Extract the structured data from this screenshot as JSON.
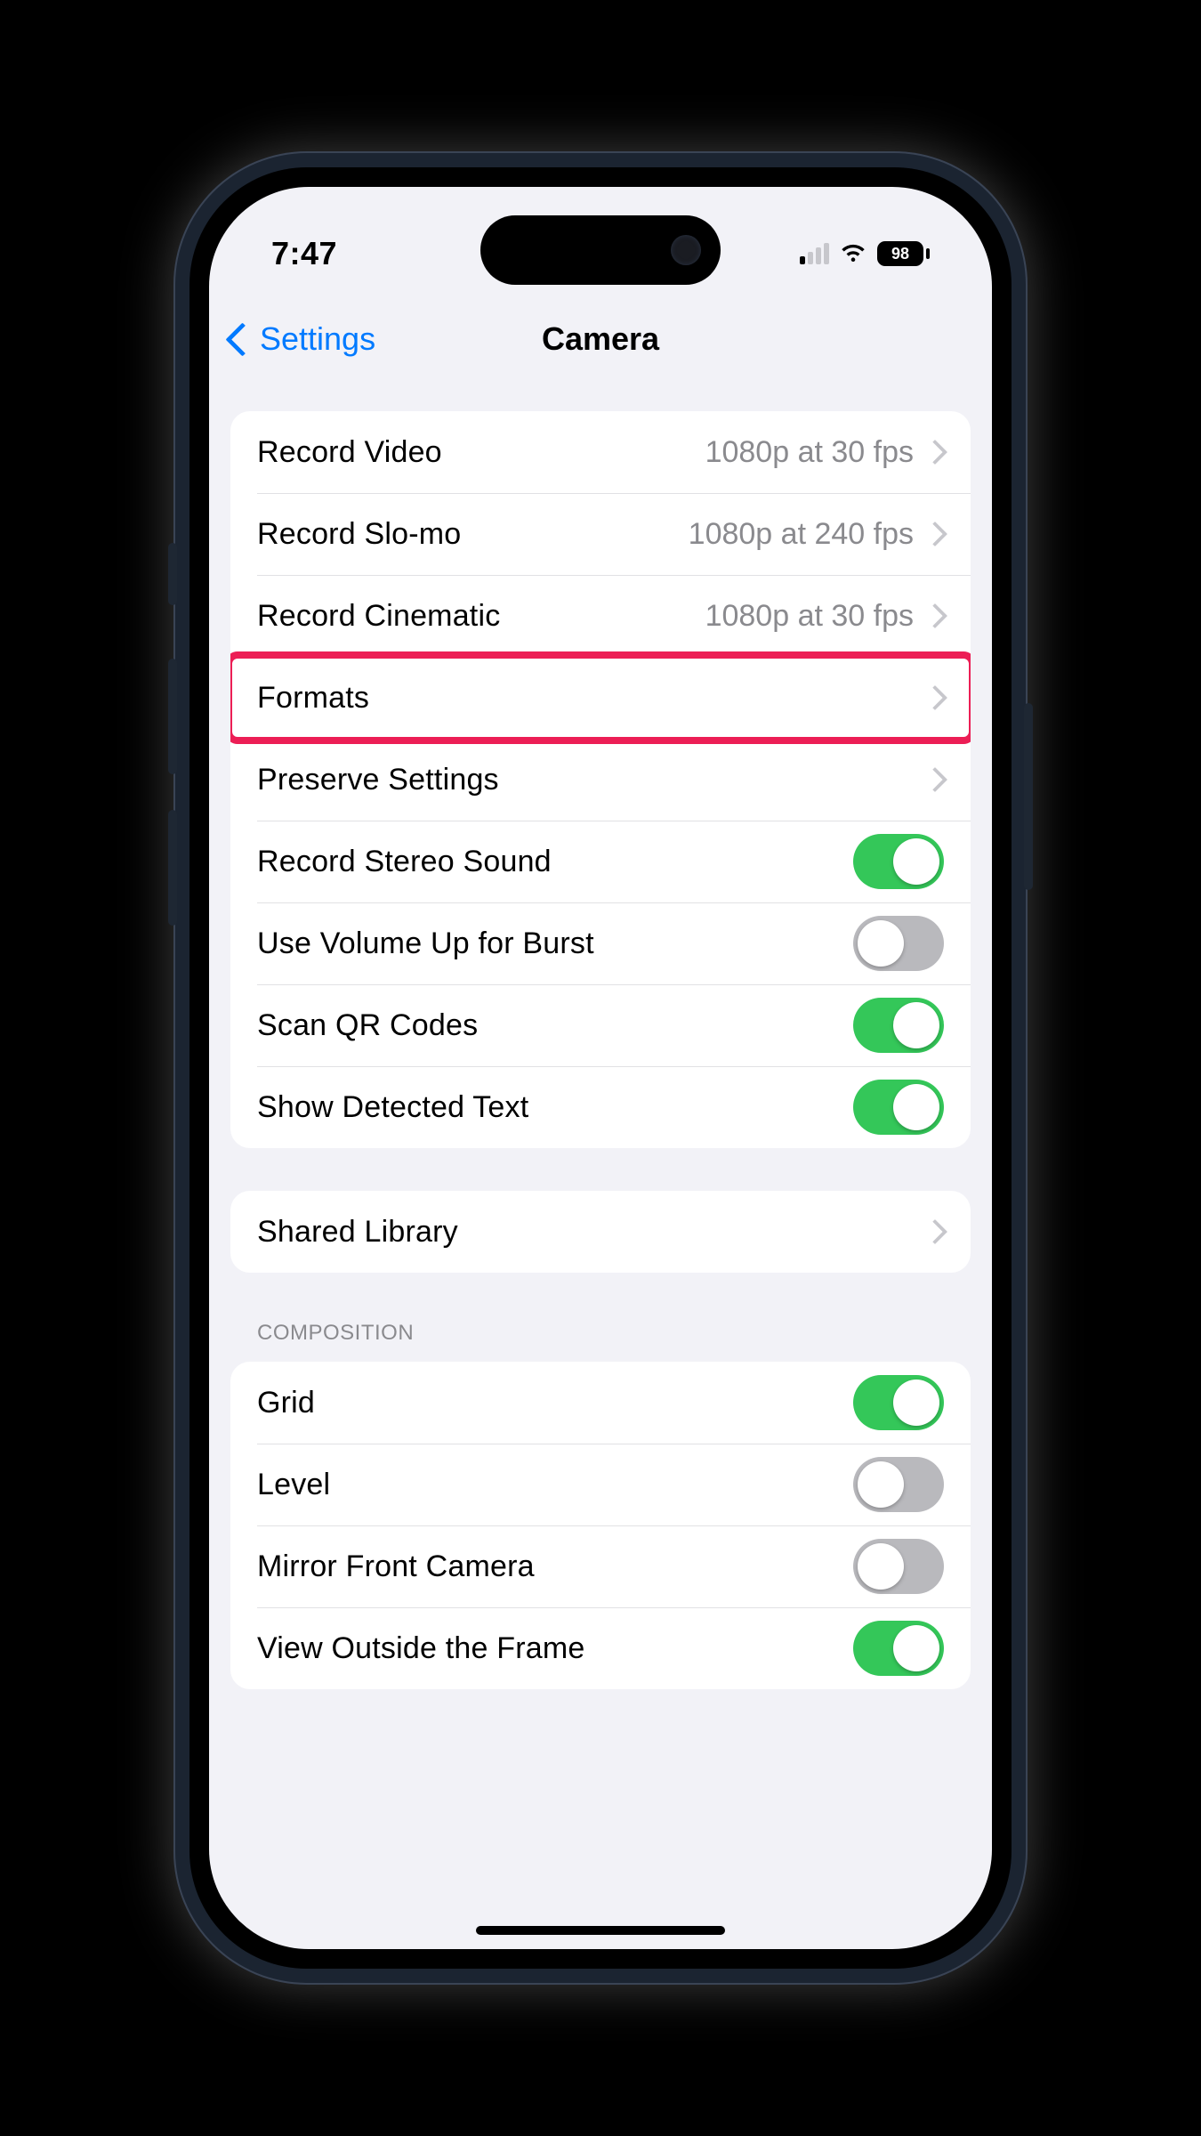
{
  "status": {
    "time": "7:47",
    "battery": "98"
  },
  "nav": {
    "back": "Settings",
    "title": "Camera"
  },
  "group1": {
    "rows": [
      {
        "label": "Record Video",
        "value": "1080p at 30 fps",
        "type": "link"
      },
      {
        "label": "Record Slo-mo",
        "value": "1080p at 240 fps",
        "type": "link"
      },
      {
        "label": "Record Cinematic",
        "value": "1080p at 30 fps",
        "type": "link"
      },
      {
        "label": "Formats",
        "value": "",
        "type": "link",
        "highlight": true
      },
      {
        "label": "Preserve Settings",
        "value": "",
        "type": "link"
      },
      {
        "label": "Record Stereo Sound",
        "type": "toggle",
        "on": true
      },
      {
        "label": "Use Volume Up for Burst",
        "type": "toggle",
        "on": false
      },
      {
        "label": "Scan QR Codes",
        "type": "toggle",
        "on": true
      },
      {
        "label": "Show Detected Text",
        "type": "toggle",
        "on": true
      }
    ]
  },
  "group2": {
    "rows": [
      {
        "label": "Shared Library",
        "value": "",
        "type": "link"
      }
    ]
  },
  "group3": {
    "header": "COMPOSITION",
    "rows": [
      {
        "label": "Grid",
        "type": "toggle",
        "on": true
      },
      {
        "label": "Level",
        "type": "toggle",
        "on": false
      },
      {
        "label": "Mirror Front Camera",
        "type": "toggle",
        "on": false
      },
      {
        "label": "View Outside the Frame",
        "type": "toggle",
        "on": true
      }
    ]
  },
  "colors": {
    "accent": "#007aff",
    "toggleOn": "#34c759",
    "highlight": "#ec1e55"
  }
}
